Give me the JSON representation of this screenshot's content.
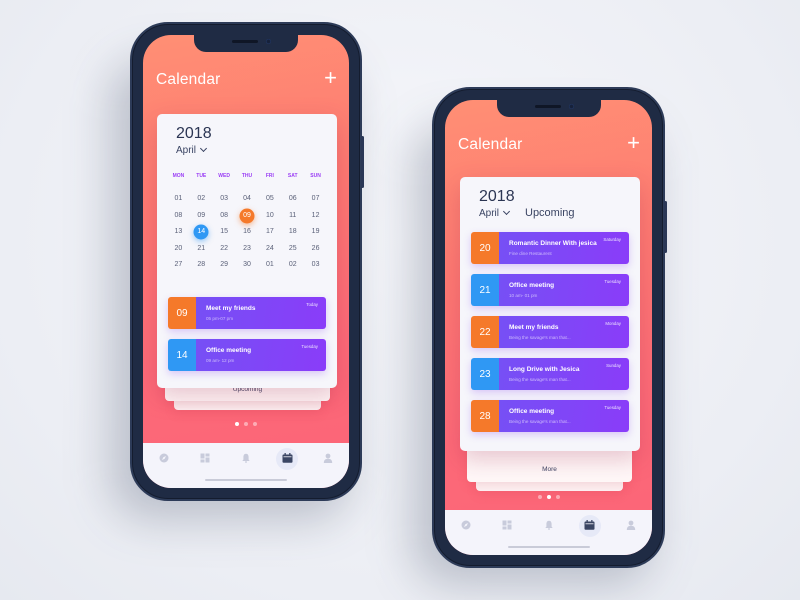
{
  "colors": {
    "accent_orange": "#f5792a",
    "accent_blue": "#2f98f4",
    "event_purple": "#8a3cf9",
    "weekday_purple": "#9a3df5",
    "gradient_top": "#ff8f74",
    "gradient_bottom": "#fb6478"
  },
  "phone1": {
    "header": {
      "title": "Calendar",
      "add_icon": "plus-icon",
      "add_label": "+"
    },
    "calendar": {
      "year": "2018",
      "month": "April",
      "month_icon": "chevron-down-icon",
      "weekdays": [
        "MON",
        "TUE",
        "WED",
        "THU",
        "FRI",
        "SAT",
        "SUN"
      ],
      "weeks": [
        [
          "01",
          "02",
          "03",
          "04",
          "05",
          "06",
          "07"
        ],
        [
          "08",
          "09",
          "08",
          "09",
          "10",
          "11",
          "12"
        ],
        [
          "13",
          "14",
          "15",
          "16",
          "17",
          "18",
          "19"
        ],
        [
          "20",
          "21",
          "22",
          "23",
          "24",
          "25",
          "26"
        ],
        [
          "27",
          "28",
          "29",
          "30",
          "01",
          "02",
          "03"
        ]
      ],
      "highlighted": [
        {
          "week": 1,
          "day": 3,
          "color": "orange"
        },
        {
          "week": 2,
          "day": 1,
          "color": "blue"
        }
      ]
    },
    "events": [
      {
        "date": "09",
        "title": "Meet my friends",
        "subtitle": "05 pm-07 pm",
        "tag": "Today",
        "color": "orange"
      },
      {
        "date": "14",
        "title": "Office meeting",
        "subtitle": "09 am- 12 pm",
        "tag": "Tuesday",
        "color": "blue"
      }
    ],
    "stack_label": "Upcoming",
    "pager": {
      "count": 3,
      "active": 0
    },
    "tabbar": {
      "items": [
        {
          "icon": "compass-icon",
          "active": false
        },
        {
          "icon": "dashboard-icon",
          "active": false
        },
        {
          "icon": "bell-icon",
          "active": false
        },
        {
          "icon": "calendar-icon",
          "active": true
        },
        {
          "icon": "user-icon",
          "active": false
        }
      ]
    }
  },
  "phone2": {
    "header": {
      "title": "Calendar",
      "add_icon": "plus-icon",
      "add_label": "+"
    },
    "calendar": {
      "year": "2018",
      "month": "April",
      "month_icon": "chevron-down-icon",
      "section_title": "Upcoming"
    },
    "events": [
      {
        "date": "20",
        "title": "Romantic Dinner With jesica",
        "subtitle": "Fine dine Restaurent",
        "tag": "Saturday",
        "color": "orange"
      },
      {
        "date": "21",
        "title": "Office meeting",
        "subtitle": "10 am- 01 pm",
        "tag": "Tuesday",
        "color": "blue"
      },
      {
        "date": "22",
        "title": "Meet my friends",
        "subtitle": "Being the savage's man that...",
        "tag": "Monday",
        "color": "orange"
      },
      {
        "date": "23",
        "title": "Long Drive with Jesica",
        "subtitle": "Being the savage's man that...",
        "tag": "Sunday",
        "color": "blue"
      },
      {
        "date": "28",
        "title": "Office meeting",
        "subtitle": "Being the savage's man that...",
        "tag": "Tuesday",
        "color": "orange"
      }
    ],
    "stack_label": "More",
    "pager": {
      "count": 3,
      "active": 1
    },
    "tabbar": {
      "items": [
        {
          "icon": "compass-icon",
          "active": false
        },
        {
          "icon": "dashboard-icon",
          "active": false
        },
        {
          "icon": "bell-icon",
          "active": false
        },
        {
          "icon": "calendar-icon",
          "active": true
        },
        {
          "icon": "user-icon",
          "active": false
        }
      ]
    }
  }
}
